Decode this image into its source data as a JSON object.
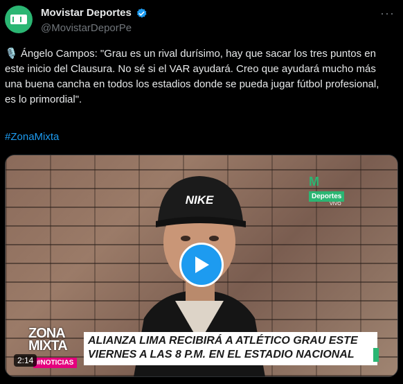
{
  "author": {
    "name": "Movistar Deportes",
    "handle": "@MovistarDeporPe"
  },
  "more_glyph": "···",
  "post": {
    "text": "🎙️ Ángelo Campos: \"Grau es un rival durísimo, hay que sacar los tres puntos en este inicio del Clausura. No sé si el VAR ayudará. Creo que ayudará mucho más una buena cancha en todos los estadios donde se pueda jugar fútbol profesional, es lo primordial\".",
    "hashtag": "#ZonaMixta"
  },
  "video": {
    "brand_label": "Deportes",
    "brand_sub": "VIVO",
    "segment_line1": "ZONA",
    "segment_line2": "MIXTA",
    "headline_line1": "ALIANZA LIMA RECIBIRÁ A ATLÉTICO GRAU ESTE",
    "headline_line2": "VIERNES A LAS 8 P.M. EN EL ESTADIO NACIONAL",
    "tag": "#NOTICIAS",
    "cap_brand": "NIKE",
    "duration": "2:14"
  },
  "colors": {
    "accent": "#1d9bf0",
    "brand_green": "#2bb673",
    "tag_pink": "#e5007e"
  }
}
